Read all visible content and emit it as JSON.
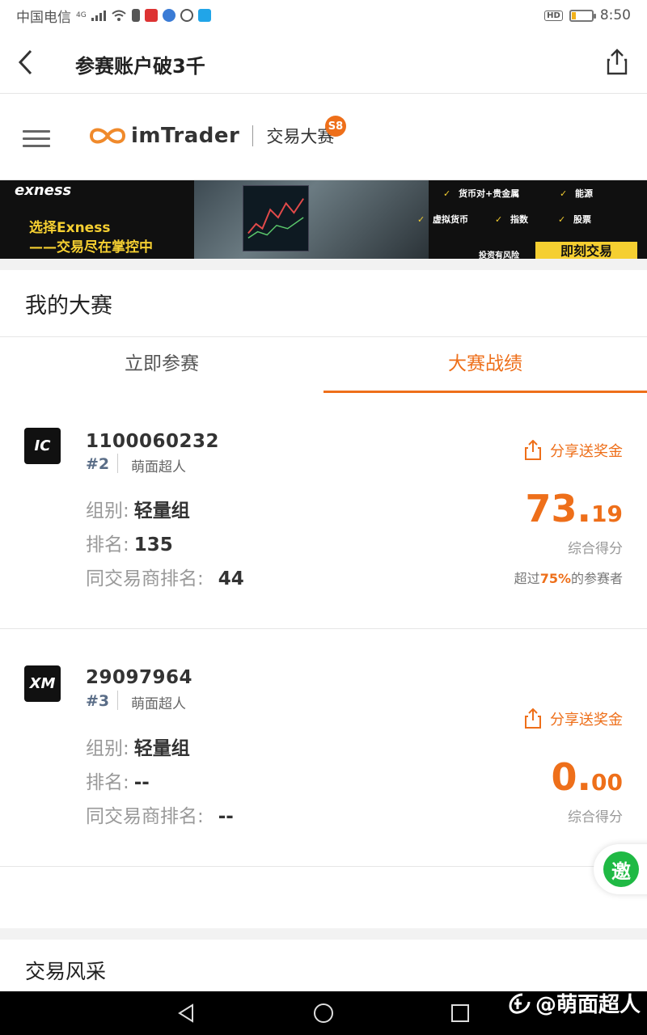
{
  "status_bar": {
    "carrier": "中国电信",
    "network": "4G",
    "hd_badge": "HD",
    "time": "8:50",
    "battery_level": 0.2
  },
  "header": {
    "title": "参赛账户破3千",
    "back_icon": "chevron-left-icon",
    "share_icon": "share-icon"
  },
  "brand": {
    "logo_text": "imTrader",
    "subtitle": "交易大赛",
    "season_badge": "S8",
    "accent_color": "#ee6f1a"
  },
  "banner": {
    "brand": "exness",
    "slogan_line1": "选择Exness",
    "slogan_line2": "——交易尽在掌控中",
    "features": [
      "货币对+贵金属",
      "能源",
      "虚拟货币",
      "指数",
      "股票"
    ],
    "risk_note": "投资有风险",
    "cta": "即刻交易"
  },
  "my_contest": {
    "title": "我的大赛",
    "tabs": [
      {
        "label": "立即参赛",
        "active": false
      },
      {
        "label": "大赛战绩",
        "active": true
      }
    ]
  },
  "accounts": [
    {
      "broker_logo": "IC",
      "account_id": "1100060232",
      "rank_tag": "#2",
      "nickname": "萌面超人",
      "group_label": "组别:",
      "group_value": "轻量组",
      "rank_label": "排名:",
      "rank_value": "135",
      "broker_rank_label": "同交易商排名:",
      "broker_rank_value": "44",
      "share_label": "分享送奖金",
      "score_int": "73.",
      "score_dec": "19",
      "score_label": "综合得分",
      "beat_prefix": "超过",
      "beat_pct": "75%",
      "beat_suffix": "的参赛者"
    },
    {
      "broker_logo": "XM",
      "account_id": "29097964",
      "rank_tag": "#3",
      "nickname": "萌面超人",
      "group_label": "组别:",
      "group_value": "轻量组",
      "rank_label": "排名:",
      "rank_value": "--",
      "broker_rank_label": "同交易商排名:",
      "broker_rank_value": "--",
      "share_label": "分享送奖金",
      "score_int": "0.",
      "score_dec": "00",
      "score_label": "综合得分"
    }
  ],
  "invite": {
    "label": "邀",
    "color": "#1fb944"
  },
  "trading_style": {
    "title": "交易风采"
  },
  "watermark": "@萌面超人",
  "nav": [
    "back-triangle-icon",
    "home-circle-icon",
    "recents-square-icon"
  ]
}
